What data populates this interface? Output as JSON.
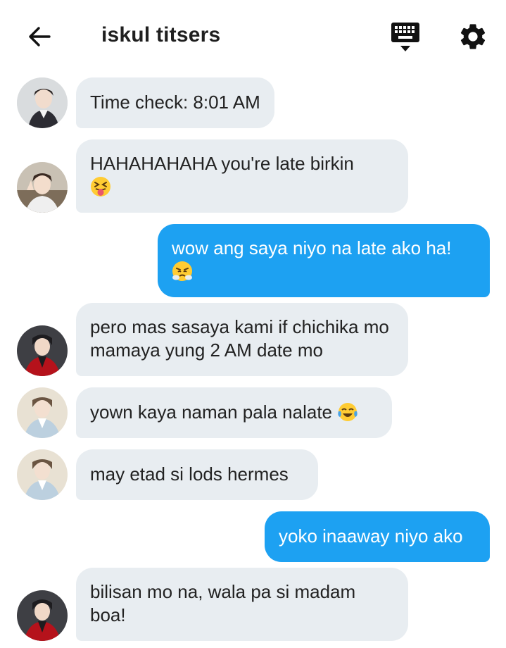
{
  "header": {
    "title": "iskul titsers",
    "back_icon": "arrow-left-icon",
    "keyboard_icon": "keyboard-hide-icon",
    "settings_icon": "gear-icon"
  },
  "colors": {
    "outgoing_bubble": "#1da1f2",
    "incoming_bubble": "#e8edf1"
  },
  "messages": [
    {
      "sender": "other",
      "avatar": "avatar-1",
      "text": "Time check: 8:01 AM"
    },
    {
      "sender": "other",
      "avatar": "avatar-2",
      "text": "HAHAHAHAHA you're late birkin",
      "emoji": "squinting-face-with-tongue"
    },
    {
      "sender": "me",
      "text": "wow ang saya niyo na late ako ha!",
      "emoji": "face-with-steam-from-nose"
    },
    {
      "sender": "other",
      "avatar": "avatar-3",
      "text": "pero mas sasaya kami if chichika mo mamaya yung 2 AM date mo"
    },
    {
      "sender": "other",
      "avatar": "avatar-4",
      "text": "yown kaya naman pala nalate",
      "emoji": "face-with-tears-of-joy"
    },
    {
      "sender": "other",
      "avatar": "avatar-4",
      "text": "may etad si lods hermes"
    },
    {
      "sender": "me",
      "text": "yoko inaaway niyo ako"
    },
    {
      "sender": "other",
      "avatar": "avatar-3",
      "text": "bilisan mo na, wala pa si madam boa!"
    }
  ]
}
